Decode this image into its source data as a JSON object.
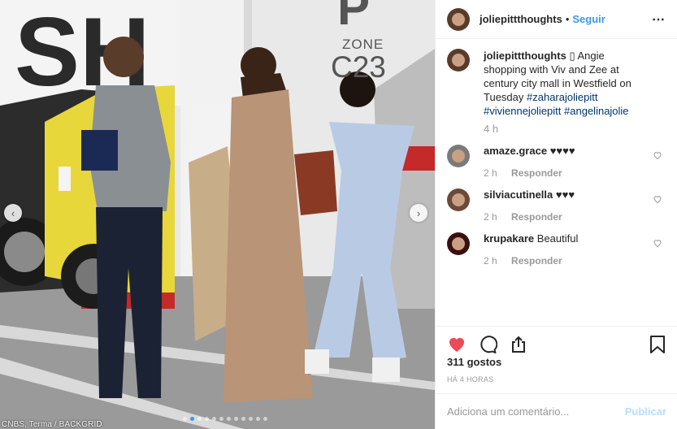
{
  "photo": {
    "credit": "CNBS, Terma / BACKGRID",
    "zone_label": "ZONE",
    "zone_number": "C23",
    "slide_count": 12,
    "active_slide": 1,
    "prev_icon": "chevron-left-icon",
    "next_icon": "chevron-right-icon"
  },
  "header": {
    "username": "joliepittthoughts",
    "separator": "•",
    "follow_label": "Seguir",
    "more_icon": "ellipsis-icon",
    "more_label": "⋯"
  },
  "caption": {
    "username": "joliepittthoughts",
    "emoji": "▯",
    "text": " Angie shopping with Viv and Zee at century city mall in Westfield on Tuesday ",
    "hashtags": [
      "#zaharajoliepitt",
      "#viviennejoliepitt",
      "#angelinajolie"
    ],
    "time": "4 h"
  },
  "comments": [
    {
      "username": "amaze.grace",
      "text": "♥♥♥♥",
      "time": "2 h",
      "reply_label": "Responder"
    },
    {
      "username": "silviacutinella",
      "text": "♥♥♥",
      "time": "2 h",
      "reply_label": "Responder"
    },
    {
      "username": "krupakare",
      "text": "Beautiful",
      "time": "2 h",
      "reply_label": "Responder"
    }
  ],
  "actions": {
    "like_icon": "heart-filled-icon",
    "comment_icon": "comment-icon",
    "share_icon": "share-icon",
    "save_icon": "bookmark-icon",
    "like_color": "#ed4956"
  },
  "likes_label": "311 gostos",
  "post_age": "HÁ 4 HORAS",
  "add_comment": {
    "placeholder": "Adiciona um comentário...",
    "publish_label": "Publicar"
  },
  "colors": {
    "link": "#3897f0",
    "hashtag": "#003569",
    "muted": "#999999",
    "publish_disabled": "#b2dffc"
  }
}
